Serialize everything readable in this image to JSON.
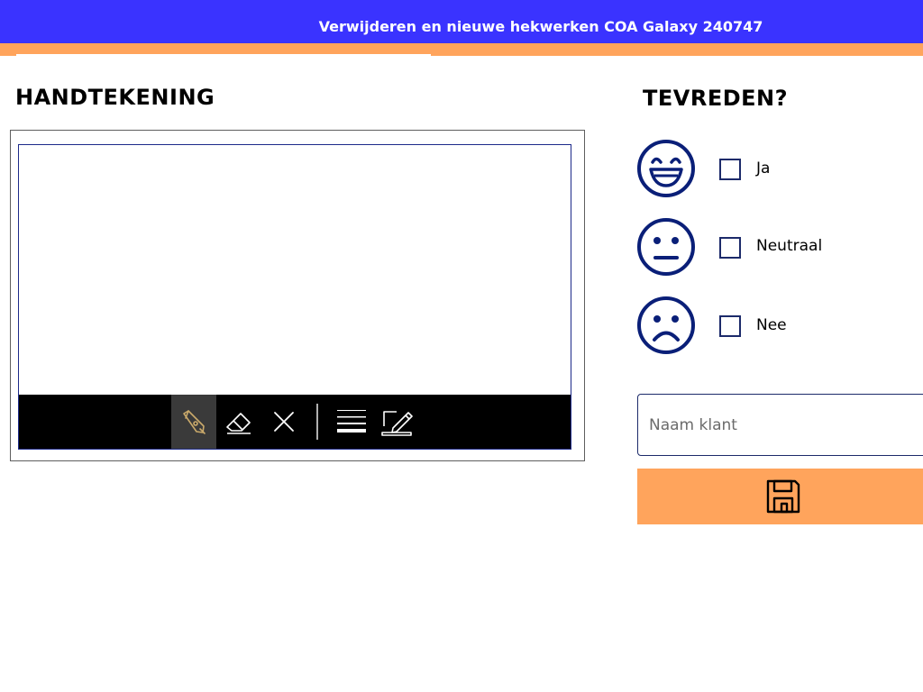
{
  "header": {
    "title": "Verwijderen en nieuwe hekwerken COA Galaxy 240747"
  },
  "signature": {
    "title": "HANDTEKENING",
    "tools": [
      "pen-icon",
      "eraser-icon",
      "clear-icon",
      "line-weight-icon",
      "pen-settings-icon"
    ],
    "active_tool": "pen-icon"
  },
  "satisfaction": {
    "title": "TEVREDEN?",
    "options": [
      {
        "label": "Ja",
        "icon": "happy-face-icon",
        "checked": false
      },
      {
        "label": "Neutraal",
        "icon": "neutral-face-icon",
        "checked": false
      },
      {
        "label": "Nee",
        "icon": "sad-face-icon",
        "checked": false
      }
    ]
  },
  "customer": {
    "name_placeholder": "Naam klant",
    "name_value": ""
  },
  "save": {
    "icon": "save-icon"
  },
  "colors": {
    "header": "#3a33ff",
    "accent": "#ffa45c",
    "icon_navy": "#0a1f78"
  }
}
